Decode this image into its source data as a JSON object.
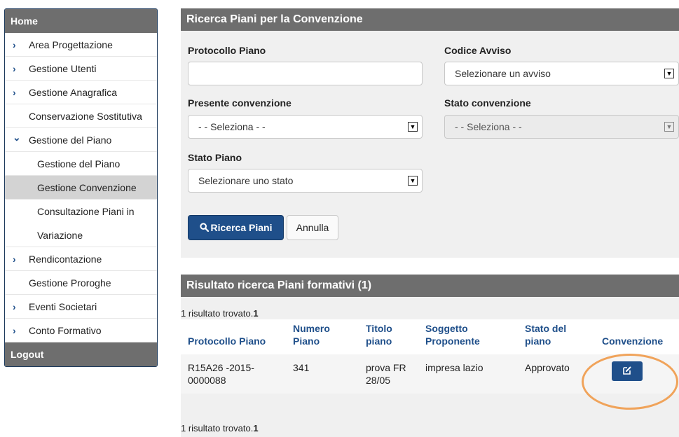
{
  "sidebar": {
    "home": "Home",
    "items": [
      {
        "label": "Area Progettazione"
      },
      {
        "label": "Gestione Utenti"
      },
      {
        "label": "Gestione Anagrafica"
      },
      {
        "label": "Conservazione Sostitutiva"
      },
      {
        "label": "Gestione del Piano"
      },
      {
        "label": "Gestione del Piano"
      },
      {
        "label": "Gestione Convenzione"
      },
      {
        "label": "Consultazione Piani in"
      },
      {
        "label": "Variazione"
      },
      {
        "label": "Rendicontazione"
      },
      {
        "label": "Gestione Proroghe"
      },
      {
        "label": "Eventi Societari"
      },
      {
        "label": "Conto Formativo"
      }
    ],
    "logout": "Logout",
    "arrow_right": "›",
    "arrow_down": "⌄"
  },
  "search": {
    "title": "Ricerca Piani per la Convenzione",
    "protocollo_label": "Protocollo Piano",
    "protocollo_value": "",
    "codice_label": "Codice Avviso",
    "codice_value": "Selezionare un avviso",
    "presente_label": "Presente convenzione",
    "presente_value": "- - Seleziona - -",
    "stato_conv_label": "Stato convenzione",
    "stato_conv_value": "- - Seleziona - -",
    "stato_piano_label": "Stato Piano",
    "stato_piano_value": "Selezionare uno stato",
    "search_button": "Ricerca Piani",
    "cancel_button": "Annulla"
  },
  "results": {
    "title": "Risultato ricerca Piani formativi (1)",
    "count_text": "1 risultato trovato.",
    "count_num": "1",
    "columns": [
      "Protocollo Piano",
      "Numero Piano",
      "Titolo piano",
      "Soggetto Proponente",
      "Stato del piano",
      "Convenzione"
    ],
    "rows": [
      {
        "protocollo": "R15A26 -2015-0000088",
        "numero": "341",
        "titolo": "prova FR 28/05",
        "soggetto": "impresa lazio",
        "stato": "Approvato"
      }
    ]
  },
  "colors": {
    "accent": "#1f4f8a",
    "header_gray": "#6e6e6e",
    "highlight": "#f0a35a"
  },
  "icons": {
    "search": "search-icon",
    "edit": "edit-icon",
    "chevron_right": "chevron-right-icon",
    "chevron_down": "chevron-down-icon",
    "select_caret": "select-caret-icon"
  }
}
